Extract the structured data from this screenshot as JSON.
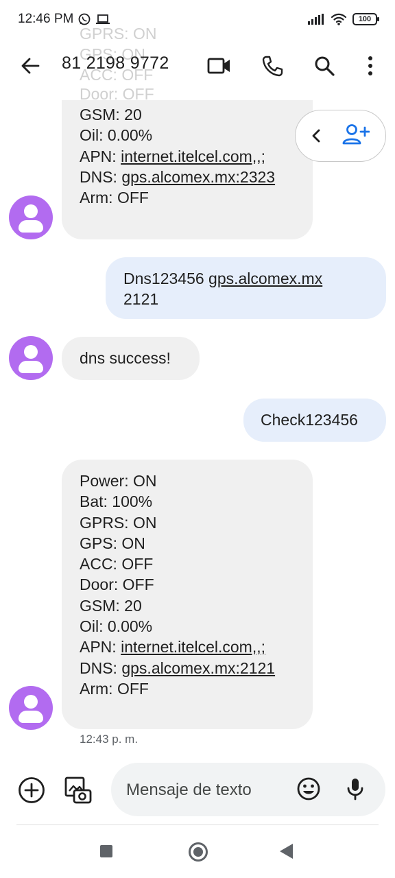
{
  "status_bar": {
    "time": "12:46 PM",
    "battery": "100"
  },
  "toolbar": {
    "title": "81 2198 9772"
  },
  "ghost_lines": [
    "GPRS: ON",
    "GPS: ON",
    "ACC: OFF",
    "Door: OFF"
  ],
  "messages": {
    "m1": {
      "lines": [
        "GSM: 20",
        "Oil: 0.00%"
      ],
      "apn_label": "APN: ",
      "apn_value": "internet.itelcel.com,,;",
      "dns_label": "DNS: ",
      "dns_value": "gps.alcomex.mx:2323",
      "arm": "Arm: OFF"
    },
    "m2": {
      "prefix": "Dns123456 ",
      "link": "gps.alcomex.mx",
      "suffix": "2121"
    },
    "m3": {
      "text": "dns success!"
    },
    "m4": {
      "text": "Check123456"
    },
    "m5": {
      "lines": [
        "Power: ON",
        "Bat: 100%",
        "GPRS: ON",
        "GPS: ON",
        "ACC: OFF",
        "Door: OFF",
        "GSM: 20",
        "Oil: 0.00%"
      ],
      "apn_label": "APN: ",
      "apn_value": "internet.itelcel.com,,;",
      "dns_label": "DNS: ",
      "dns_value": "gps.alcomex.mx:2121",
      "arm": "Arm: OFF"
    },
    "timestamp": "12:43 p. m."
  },
  "compose": {
    "placeholder": "Mensaje de texto"
  },
  "colors": {
    "avatar": "#b26bf0",
    "outgoing_bubble": "#e6eefb",
    "incoming_bubble": "#f0f0f0",
    "accent_blue": "#1a73e8"
  }
}
